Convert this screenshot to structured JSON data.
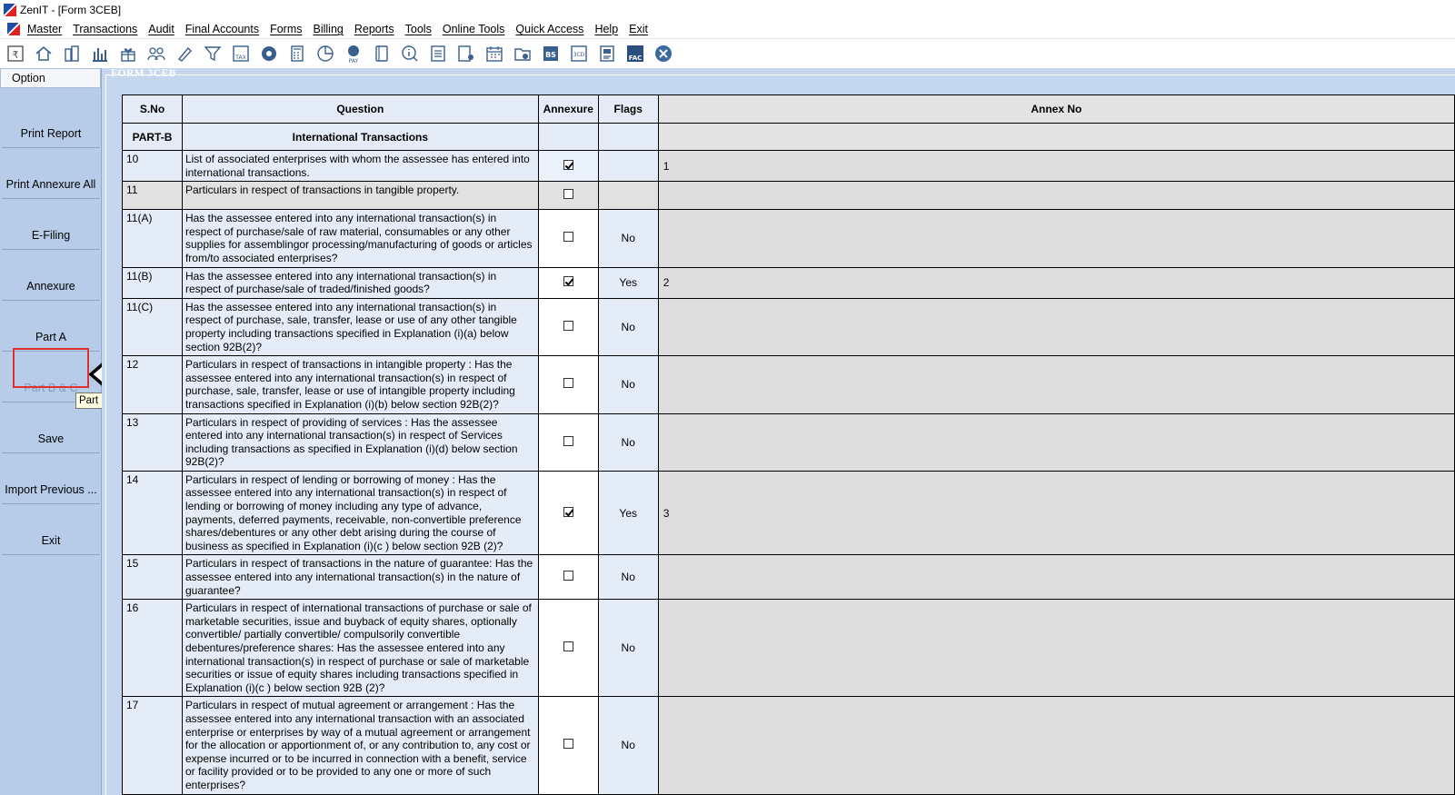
{
  "window": {
    "title": "ZenIT - [Form 3CEB]"
  },
  "menu": [
    "Master",
    "Transactions",
    "Audit",
    "Final Accounts",
    "Forms",
    "Billing",
    "Reports",
    "Tools",
    "Online Tools",
    "Quick Access",
    "Help",
    "Exit"
  ],
  "toolbar_icons": [
    "rupee-book-icon",
    "home-icon",
    "buildings-icon",
    "bar-chart-icon",
    "gift-icon",
    "users-icon",
    "pen-icon",
    "filter-icon",
    "tax-save-icon",
    "disc-icon",
    "calculator-icon",
    "pie-chart-icon",
    "pay-icon",
    "book-icon",
    "info-icon",
    "ledger-icon",
    "document-user-icon",
    "calendar-icon",
    "folder-add-icon",
    "bs-icon",
    "3cd-icon",
    "report-icon",
    "fac-icon",
    "close-circle-icon"
  ],
  "sidebar": {
    "header": "Option",
    "buttons": [
      "Print Report",
      "Print Annexure All",
      "E-Filing",
      "Annexure",
      "Part A",
      "Part B & C",
      "Save",
      "Import Previous ...",
      "Exit"
    ],
    "tooltip": "Part B  C"
  },
  "form": {
    "label": "FORM 3CEB",
    "columns": [
      "S.No",
      "Question",
      "Annexure",
      "Flags",
      "Annex No"
    ],
    "part_row": {
      "sno": "PART-B",
      "question": "International Transactions"
    },
    "rows": [
      {
        "sno": "10",
        "question": "List of associated enterprises with whom the assessee has entered into international transactions.",
        "checked": true,
        "flag": "",
        "annex": "1"
      },
      {
        "sno": "11",
        "question": "Particulars in respect of transactions in tangible property.",
        "checked": false,
        "flag": "",
        "annex": ""
      },
      {
        "sno": "11(A)",
        "question": "Has the assessee entered into any international transaction(s) in respect of purchase/sale of raw material, consumables or any other supplies for assemblingor processing/manufacturing of goods or articles from/to associated enterprises?",
        "checked": false,
        "flag": "No",
        "annex": ""
      },
      {
        "sno": "11(B)",
        "question": "Has the assessee entered into any international transaction(s) in respect of purchase/sale of traded/finished goods?",
        "checked": true,
        "flag": "Yes",
        "annex": "2"
      },
      {
        "sno": "11(C)",
        "question": "Has the assessee entered into any international transaction(s) in respect of purchase, sale, transfer, lease or use of any other tangible property including transactions specified in Explanation (i)(a) below section 92B(2)?",
        "checked": false,
        "flag": "No",
        "annex": ""
      },
      {
        "sno": "12",
        "question": "Particulars in respect of transactions in intangible property : Has the assessee entered into any international transaction(s) in respect of purchase, sale, transfer, lease or use of intangible property including transactions specified in Explanation (i)(b) below section 92B(2)?",
        "checked": false,
        "flag": "No",
        "annex": ""
      },
      {
        "sno": "13",
        "question": "Particulars in respect of providing of services : Has the assessee entered into any international transaction(s) in respect of Services including transactions as specified in Explanation (i)(d) below section 92B(2)?",
        "checked": false,
        "flag": "No",
        "annex": ""
      },
      {
        "sno": "14",
        "question": "Particulars in respect of lending or borrowing of money : Has the assessee entered into any international transaction(s) in respect of lending or borrowing of money including any type of advance, payments, deferred payments, receivable, non-convertible preference shares/debentures or any other debt arising during the course of business as specified in Explanation (i)(c ) below section 92B (2)?",
        "checked": true,
        "flag": "Yes",
        "annex": "3"
      },
      {
        "sno": "15",
        "question": "Particulars in respect of transactions in the nature of guarantee: Has the assessee entered into any international transaction(s) in the nature of guarantee?",
        "checked": false,
        "flag": "No",
        "annex": ""
      },
      {
        "sno": "16",
        "question": "Particulars in respect of international transactions of purchase or sale of marketable securities, issue and buyback of equity shares, optionally convertible/ partially convertible/ compulsorily convertible debentures/preference shares: Has the assessee entered into any international transaction(s) in respect of purchase or sale of marketable securities or issue of equity shares including transactions specified in Explanation (i)(c ) below section 92B (2)?",
        "checked": false,
        "flag": "No",
        "annex": ""
      },
      {
        "sno": "17",
        "question": "Particulars in respect of mutual agreement or arrangement : Has the assessee entered into any international transaction with an associated enterprise or enterprises by way of a mutual agreement or arrangement for the allocation or apportionment of, or any contribution to, any cost or expense incurred or to be incurred in connection with a benefit, service or facility provided or to be provided to any one or more of such enterprises?",
        "checked": false,
        "flag": "No",
        "annex": ""
      }
    ]
  }
}
